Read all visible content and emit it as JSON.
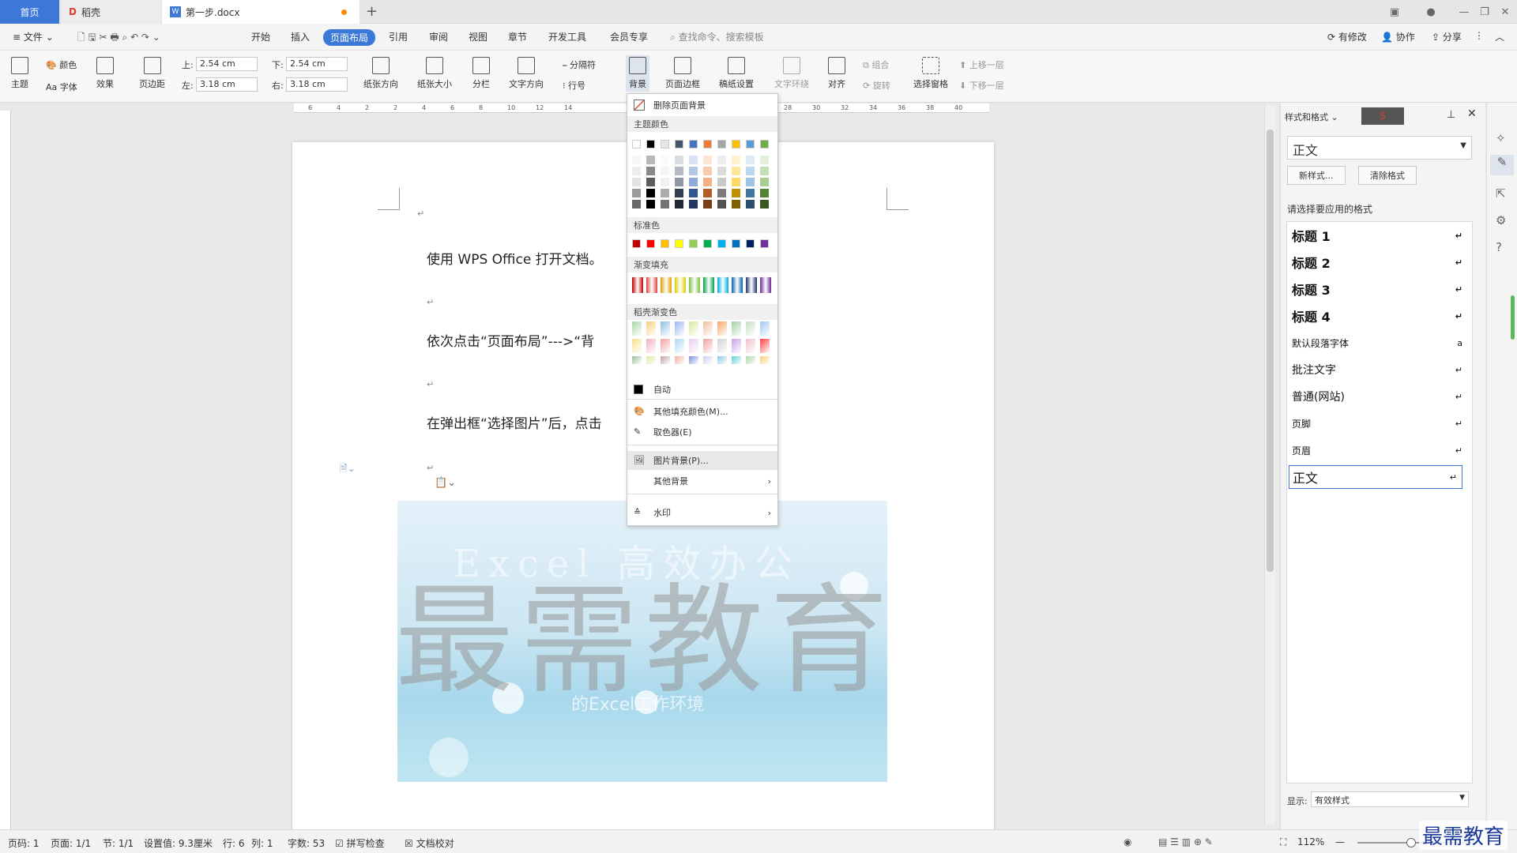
{
  "tabs": {
    "home": "首页",
    "daoke": "稻壳",
    "doc": "第一步.docx"
  },
  "menu": {
    "file": "文件",
    "items": [
      "开始",
      "插入",
      "页面布局",
      "引用",
      "审阅",
      "视图",
      "章节",
      "开发工具",
      "会员专享"
    ],
    "search_placeholder": "查找命令、搜索模板",
    "right": [
      "有修改",
      "协作",
      "分享"
    ]
  },
  "ribbon": {
    "theme": "主题",
    "color": "颜色",
    "font": "Aa 字体",
    "effect": "效果",
    "margins": "页边距",
    "top_label": "上:",
    "top_value": "2.54 cm",
    "bottom_label": "下:",
    "bottom_value": "2.54 cm",
    "left_label": "左:",
    "left_value": "3.18 cm",
    "right_label": "右:",
    "right_value": "3.18 cm",
    "orientation": "纸张方向",
    "size": "纸张大小",
    "columns": "分栏",
    "text_dir": "文字方向",
    "separator": "分隔符",
    "line_no": "行号",
    "background": "背景",
    "page_border": "页面边框",
    "grid": "稿纸设置",
    "wrap": "文字环绕",
    "align": "对齐",
    "group": "组合",
    "rotate": "旋转",
    "select_pane": "选择窗格",
    "up": "上移一层",
    "down": "下移一层"
  },
  "ruler_ticks": [
    "6",
    "4",
    "2",
    "2",
    "4",
    "6",
    "8",
    "10",
    "12",
    "14",
    "28",
    "30",
    "32",
    "34",
    "36",
    "38",
    "40"
  ],
  "document": {
    "line1": "使用 WPS Office 打开文档。",
    "line2": "依次点击“页面布局”--->“背",
    "line3": "在弹出框“选择图片”后，点击",
    "image_text_top": "Excel 高效办公",
    "image_text_bottom": "的Excel工作环境",
    "watermark": "最需教育"
  },
  "dropdown": {
    "remove_bg": "删除页面背景",
    "theme_colors": "主题颜色",
    "standard_colors": "标准色",
    "gradient_fill": "渐变填充",
    "daoke_gradient": "稻壳渐变色",
    "auto": "自动",
    "more_colors": "其他填充颜色(M)...",
    "picker": "取色器(E)",
    "picture_bg": "图片背景(P)...",
    "other_bg": "其他背景",
    "watermark": "水印",
    "theme_row": [
      "#ffffff",
      "#000000",
      "#e7e6e6",
      "#44546a",
      "#4472c4",
      "#ed7d31",
      "#a5a5a5",
      "#ffc000",
      "#5b9bd5",
      "#70ad47"
    ],
    "standard_row": [
      "#c00000",
      "#ff0000",
      "#ffc000",
      "#ffff00",
      "#92d050",
      "#00b050",
      "#00b0f0",
      "#0070c0",
      "#002060",
      "#7030a0"
    ],
    "gradient_row": [
      "#c00000",
      "#e04040",
      "#e0a000",
      "#d8d000",
      "#7cc040",
      "#00a050",
      "#00a8e0",
      "#0060b0",
      "#1a3070",
      "#6a2a98"
    ]
  },
  "right_panel": {
    "title": "样式和格式",
    "current": "正文",
    "new_style": "新样式...",
    "clear": "清除格式",
    "prompt": "请选择要应用的格式",
    "styles": [
      "标题 1",
      "标题 2",
      "标题 3",
      "标题 4",
      "默认段落字体",
      "批注文字",
      "普通(网站)",
      "页脚",
      "页眉",
      "正文"
    ],
    "show_label": "显示:",
    "show_value": "有效样式"
  },
  "status": {
    "page_no": "页码: 1",
    "pages": "页面: 1/1",
    "section": "节: 1/1",
    "setting": "设置值: 9.3厘米",
    "row": "行: 6",
    "col": "列: 1",
    "words": "字数: 53",
    "spell": "拼写检查",
    "proof": "文档校对",
    "zoom": "112%",
    "brand": "最需教育"
  }
}
